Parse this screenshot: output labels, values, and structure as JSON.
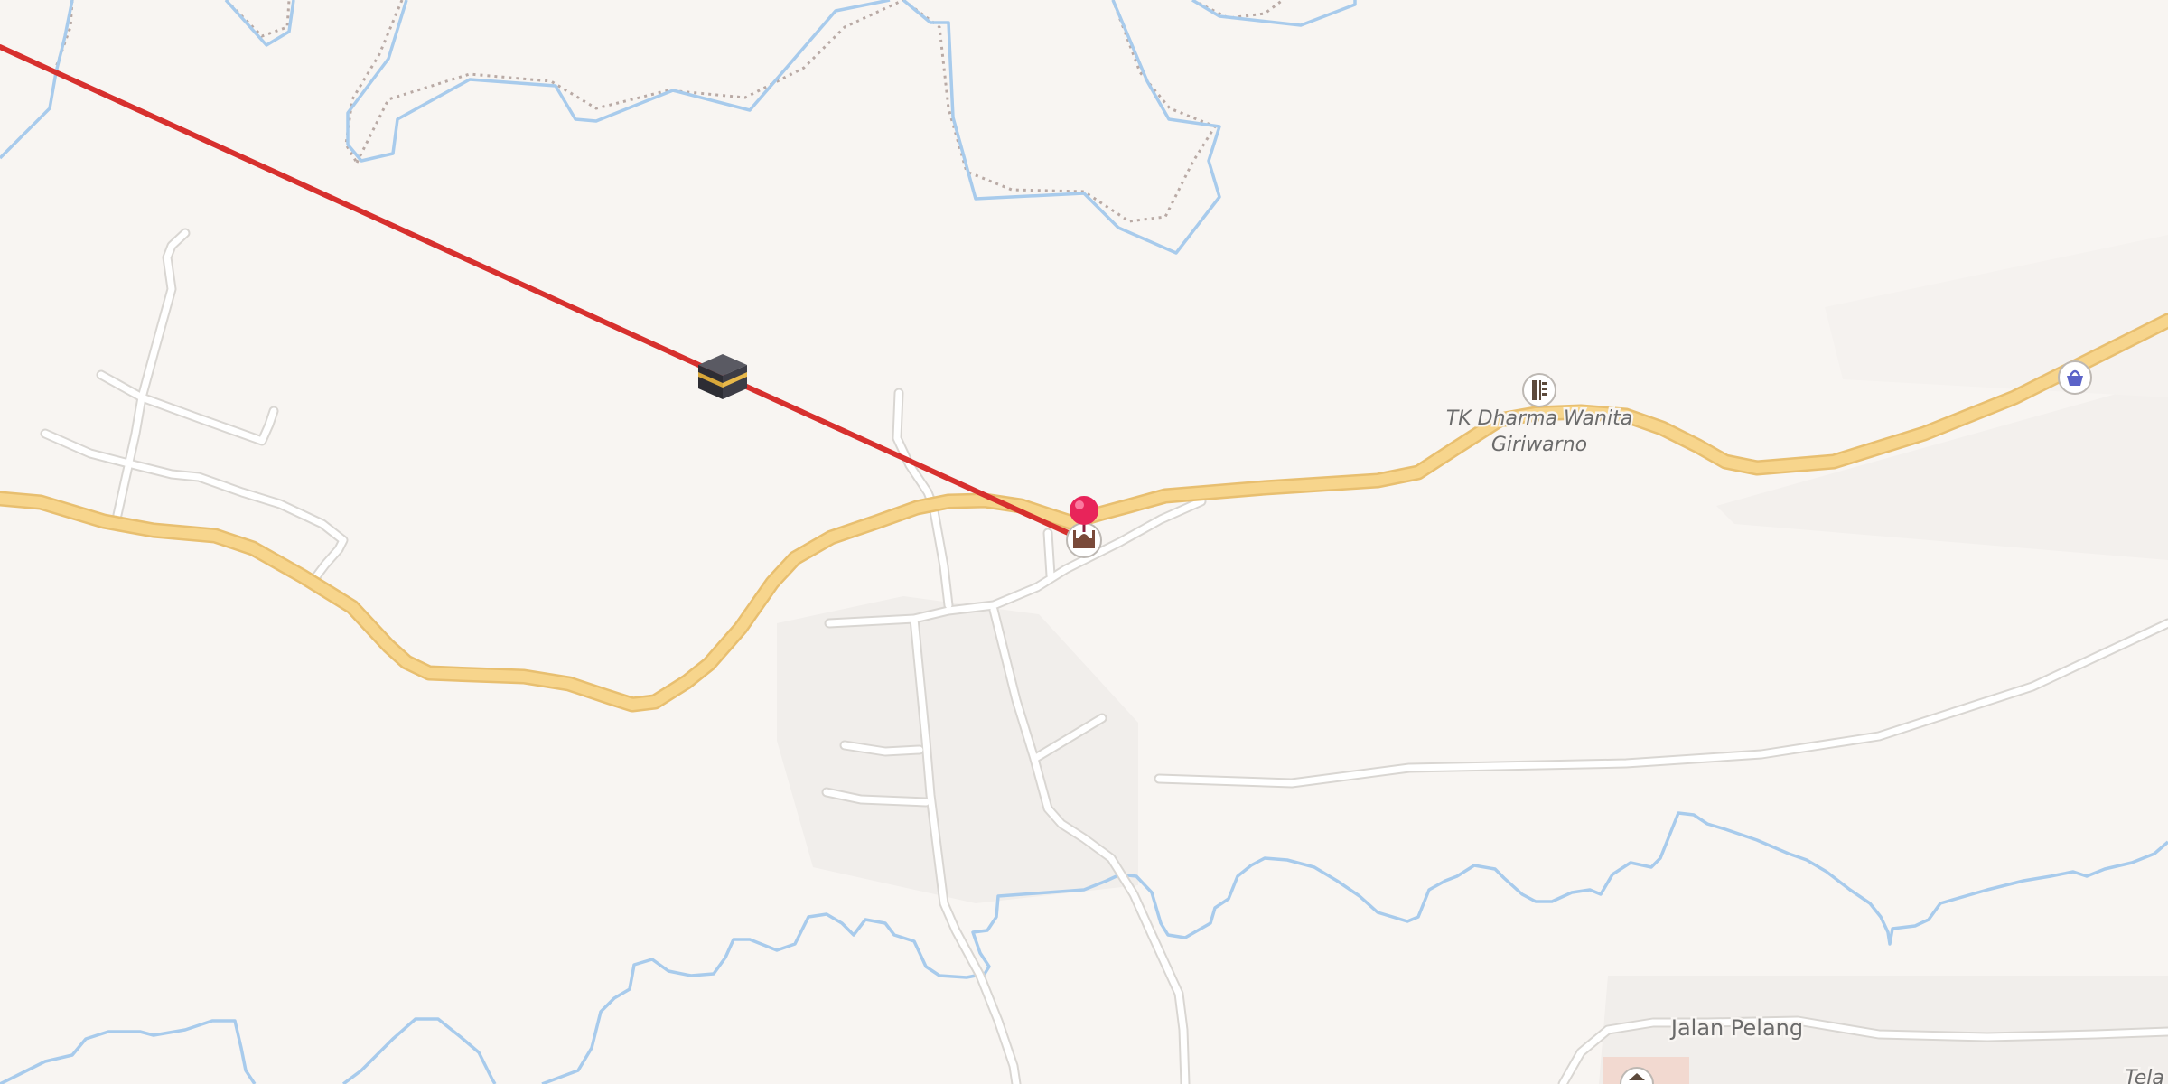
{
  "map": {
    "labels": {
      "school_name_line1": "TK Dharma Wanita",
      "school_name_line2": "Giriwarno",
      "street_pelang": "Jalan Pelang",
      "partial_label": "Tela"
    },
    "markers": {
      "location_pin": "location-pin-icon",
      "mosque": "mosque-icon",
      "kaaba": "kaaba-icon",
      "school": "school-icon",
      "shop": "shopping-basket-icon",
      "building": "building-icon"
    },
    "colors": {
      "background": "#f8f5f2",
      "primary_road": "#f7d58c",
      "primary_road_casing": "#e8bf70",
      "minor_road": "#ffffff",
      "minor_road_casing": "#d9d6d2",
      "river": "#a8cbec",
      "boundary": "#b9aaa5",
      "qibla_line": "#d7302e",
      "pin": "#e8245a"
    }
  }
}
